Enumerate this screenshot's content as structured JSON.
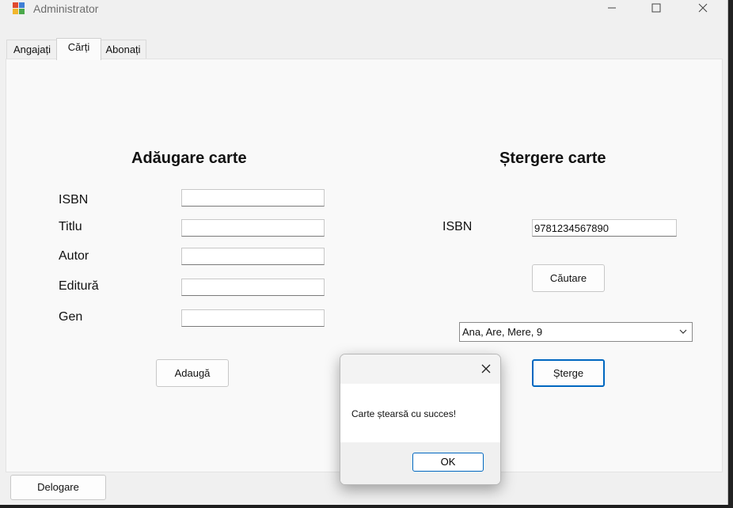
{
  "window": {
    "title": "Administrator"
  },
  "tabs": [
    {
      "label": "Angajați"
    },
    {
      "label": "Cărți"
    },
    {
      "label": "Abonați"
    }
  ],
  "add_section": {
    "heading": "Adăugare carte",
    "fields": [
      {
        "label": "ISBN",
        "value": ""
      },
      {
        "label": "Titlu",
        "value": ""
      },
      {
        "label": "Autor",
        "value": ""
      },
      {
        "label": "Editură",
        "value": ""
      },
      {
        "label": "Gen",
        "value": ""
      }
    ],
    "add_button": "Adaugă"
  },
  "delete_section": {
    "heading": "Ștergere carte",
    "isbn_label": "ISBN",
    "isbn_value": "9781234567890",
    "search_button": "Căutare",
    "result_selected": "Ana, Are, Mere, 9",
    "delete_button": "Șterge"
  },
  "dialog": {
    "message": "Carte ștearsă cu succes!",
    "ok_button": "OK"
  },
  "logout_button": "Delogare",
  "colors": {
    "accent": "#0067c0",
    "panel_bg": "#f9f9f9",
    "window_bg": "#f0f0f0"
  }
}
